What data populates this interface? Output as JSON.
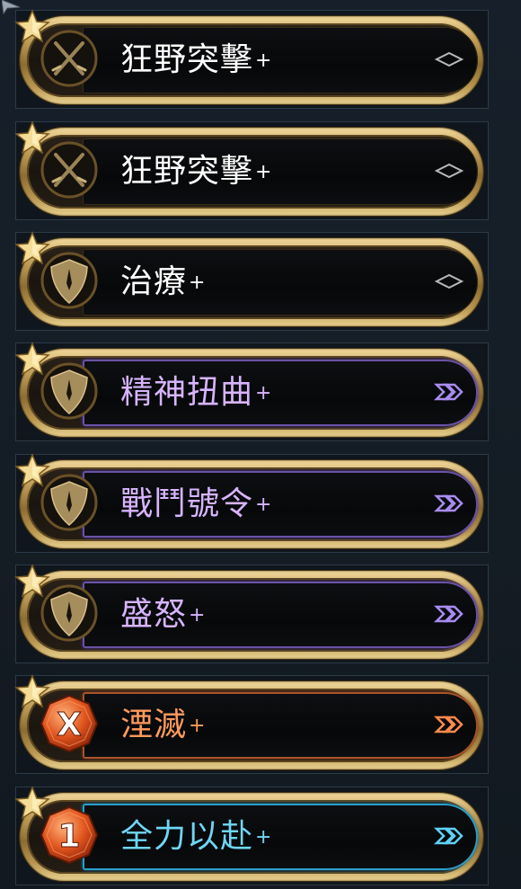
{
  "cards": [
    {
      "name": "狂野突擊",
      "plus": "+",
      "icon": "crossed-swords-icon",
      "emblem": "swords",
      "tier": "common",
      "color": "#ffffff"
    },
    {
      "name": "狂野突擊",
      "plus": "+",
      "icon": "crossed-swords-icon",
      "emblem": "swords",
      "tier": "common",
      "color": "#ffffff"
    },
    {
      "name": "治療",
      "plus": "+",
      "icon": "shield-icon",
      "emblem": "shield",
      "tier": "common",
      "color": "#ffffff"
    },
    {
      "name": "精神扭曲",
      "plus": "+",
      "icon": "shield-icon",
      "emblem": "shield",
      "tier": "purple",
      "color": "#d7b4ff"
    },
    {
      "name": "戰鬥號令",
      "plus": "+",
      "icon": "shield-icon",
      "emblem": "shield",
      "tier": "purple",
      "color": "#d7b4ff"
    },
    {
      "name": "盛怒",
      "plus": "+",
      "icon": "shield-icon",
      "emblem": "shield",
      "tier": "purple",
      "color": "#d7b4ff"
    },
    {
      "name": "湮滅",
      "plus": "+",
      "icon": "cost-x-gem-icon",
      "emblem": "gem",
      "cost": "X",
      "tier": "orange",
      "color": "#ff9a5c"
    },
    {
      "name": "全力以赴",
      "plus": "+",
      "icon": "cost-1-gem-icon",
      "emblem": "gem",
      "cost": "1",
      "tier": "cyan",
      "color": "#6fd6f4"
    }
  ],
  "colors": {
    "gold": "#c6a35c",
    "purple": "#8a6ee0",
    "orange": "#e36a34",
    "cyan": "#3cc0ea"
  }
}
